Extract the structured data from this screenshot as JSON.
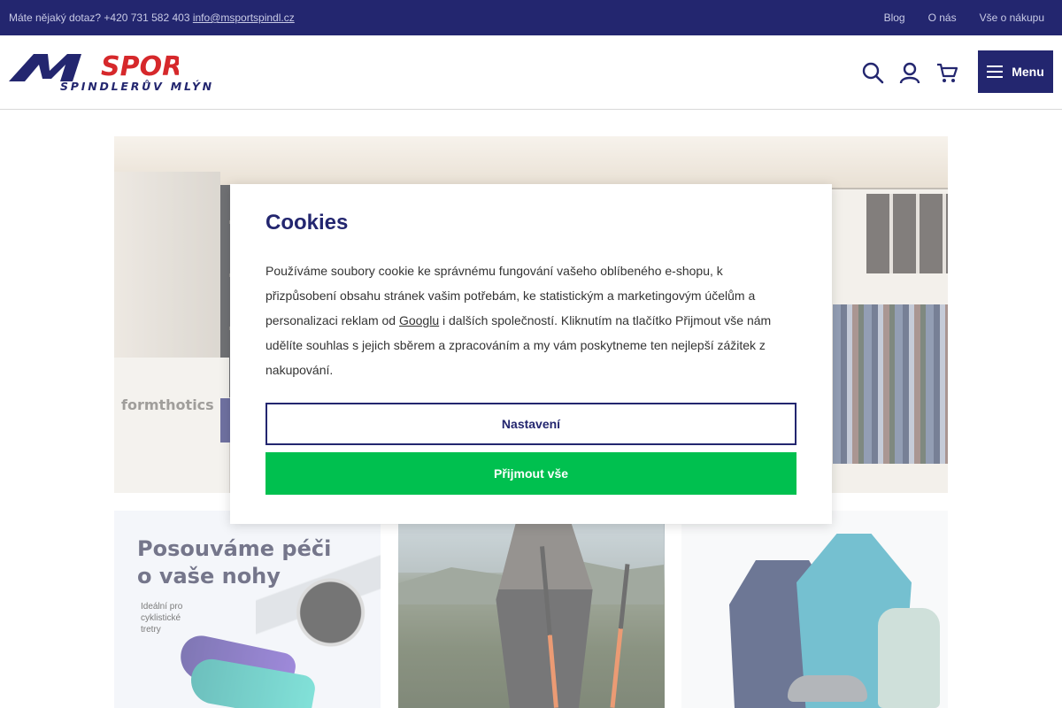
{
  "topbar": {
    "question": "Máte nějaký dotaz? +420 731 582 403",
    "email": "info@msportspindl.cz",
    "links": [
      "Blog",
      "O nás",
      "Vše o nákupu"
    ]
  },
  "header": {
    "logo_main": "SPORT",
    "logo_sub": "ŠPINDLERŮV MLÝN",
    "menu_label": "Menu",
    "icons": [
      "search-icon",
      "user-icon",
      "cart-icon"
    ]
  },
  "hero": {
    "brand_sign": "formthotics"
  },
  "tiles": {
    "tile1_heading_line1": "Posouváme péči",
    "tile1_heading_line2": "o vaše nohy",
    "tile1_note": "Ideální pro cyklistické tretry"
  },
  "cookie": {
    "title": "Cookies",
    "text_before": "Používáme soubory cookie ke správnému fungování vašeho oblíbeného e-shopu, k přizpůsobení obsahu stránek vašim potřebám, ke statistickým a marketingovým účelům a personalizaci reklam od ",
    "link_text": "Googlu",
    "text_after": " i dalších společností. Kliknutím na tlačítko Přijmout vše nám udělíte souhlas s jejich sběrem a zpracováním a my vám poskytneme ten nejlepší zážitek z nakupování.",
    "settings_label": "Nastavení",
    "accept_label": "Přijmout vše"
  },
  "colors": {
    "brand_navy": "#23266f",
    "accept_green": "#00c04f"
  }
}
